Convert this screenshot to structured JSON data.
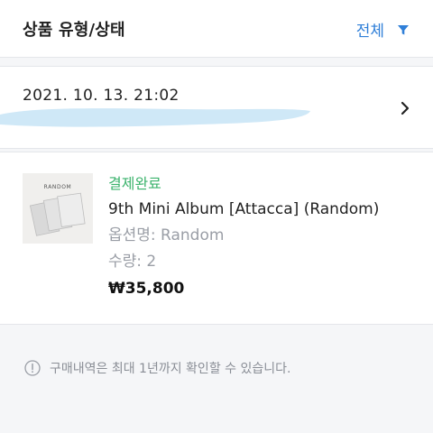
{
  "header": {
    "title": "상품 유형/상태",
    "filter_label": "전체",
    "filter_icon": "filter-icon"
  },
  "order": {
    "date": "2021. 10. 13. 21:02",
    "chevron_icon": "chevron-right-icon"
  },
  "item": {
    "thumbnail_text": "RANDOM",
    "status": "결제완료",
    "product_name": "9th Mini Album [Attacca] (Random)",
    "option": "옵션명: Random",
    "quantity": "수량: 2",
    "price": "₩35,800"
  },
  "notice": {
    "icon": "info-icon",
    "text": "구매내역은 최대 1년까지 확인할 수 있습니다."
  },
  "colors": {
    "accent": "#2f7fd8",
    "status_green": "#3bb36c",
    "muted_text": "#9a9ea6",
    "redaction": "#cfe8f7"
  }
}
